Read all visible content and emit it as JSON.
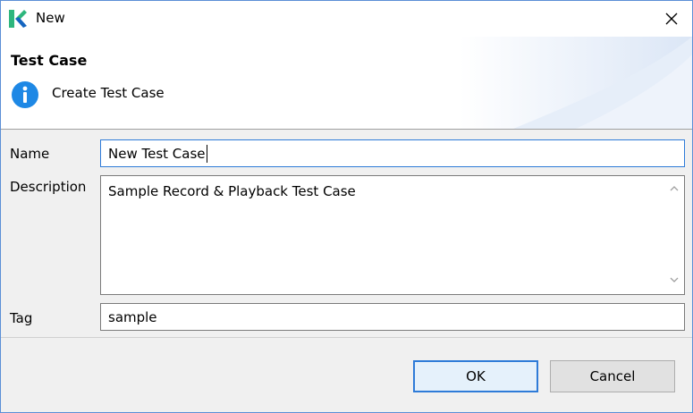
{
  "window": {
    "title": "New"
  },
  "banner": {
    "title": "Test Case",
    "message": "Create Test Case"
  },
  "form": {
    "name_label": "Name",
    "name_value": "New Test Case",
    "description_label": "Description",
    "description_value": "Sample Record & Playback Test Case",
    "tag_label": "Tag",
    "tag_value": "sample"
  },
  "buttons": {
    "ok": "OK",
    "cancel": "Cancel"
  },
  "colors": {
    "accent": "#2e7bd8",
    "info_icon": "#1e88e5",
    "logo_green": "#2eb67d",
    "logo_blue": "#1565c0"
  }
}
